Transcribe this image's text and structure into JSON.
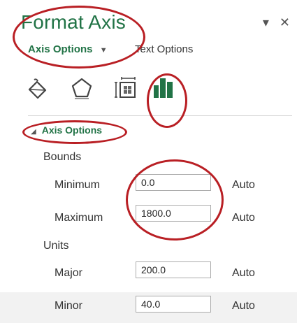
{
  "panel": {
    "title": "Format Axis",
    "controls": {
      "dropdown": "▾",
      "close": "✕"
    }
  },
  "tabs": {
    "axis_options": "Axis Options",
    "axis_options_caret": "▼",
    "text_options": "Text Options"
  },
  "icons": [
    "fill-line-icon",
    "effects-pentagon-icon",
    "size-properties-icon",
    "axis-options-bar-chart-icon"
  ],
  "section": {
    "title": "Axis Options",
    "collapse": "◢"
  },
  "bounds": {
    "label": "Bounds",
    "minimum": {
      "label": "Minimum",
      "value": "0.0",
      "auto": "Auto"
    },
    "maximum": {
      "label": "Maximum",
      "value": "1800.0",
      "auto": "Auto"
    }
  },
  "units": {
    "label": "Units",
    "major": {
      "label": "Major",
      "value": "200.0",
      "auto": "Auto"
    },
    "minor": {
      "label": "Minor",
      "value": "40.0",
      "auto": "Auto"
    }
  },
  "colors": {
    "accent": "#217346",
    "highlight": "#b91f24",
    "chart_icon_green": "#217346"
  }
}
